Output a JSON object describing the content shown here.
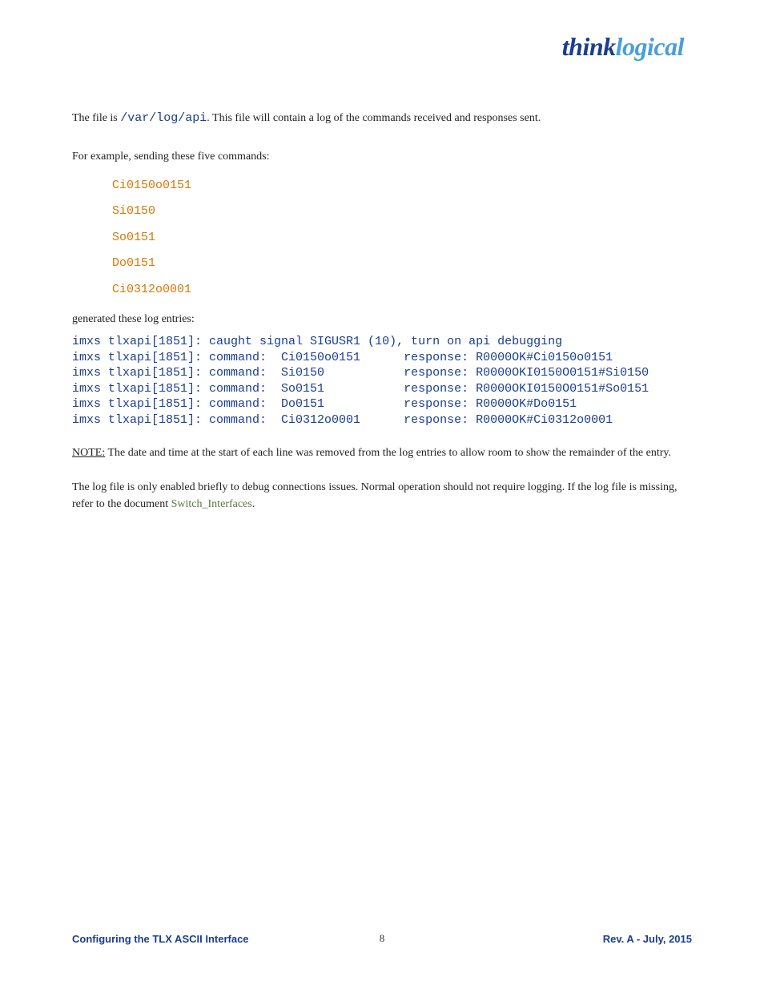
{
  "logo": {
    "part1": "think",
    "part2": "logical"
  },
  "log_path_line": {
    "prefix": "The file is ",
    "path": "/var/log/api",
    "suffix": ". This file will contain a log of the commands received and responses sent."
  },
  "example_intro": "For example, sending these five commands:",
  "commands": [
    "Ci0150o0151",
    "Si0150",
    "So0151",
    "Do0151",
    "Ci0312o0001"
  ],
  "generated_label": "generated these log entries:",
  "log_output": "imxs tlxapi[1851]: caught signal SIGUSR1 (10), turn on api debugging\nimxs tlxapi[1851]: command:  Ci0150o0151      response: R0000OK#Ci0150o0151\nimxs tlxapi[1851]: command:  Si0150           response: R0000OKI0150O0151#Si0150\nimxs tlxapi[1851]: command:  So0151           response: R0000OKI0150O0151#So0151\nimxs tlxapi[1851]: command:  Do0151           response: R0000OK#Do0151\nimxs tlxapi[1851]: command:  Ci0312o0001      response: R0000OK#Ci0312o0001",
  "note_label": "NOTE:",
  "note_text": " The date and time at the start of each line was removed from the log entries to allow room to show the remainder of the entry.",
  "note_para_prefix": "The log file is only enabled briefly to debug connections issues. Normal operation should not require logging. If the log file is missing, refer to the document ",
  "note_para_green": "Switch_Interfaces",
  "note_para_suffix": ".",
  "footer": {
    "left": "Configuring the TLX ASCII Interface",
    "right": "Rev. A - July, 2015"
  },
  "page_number": "8"
}
